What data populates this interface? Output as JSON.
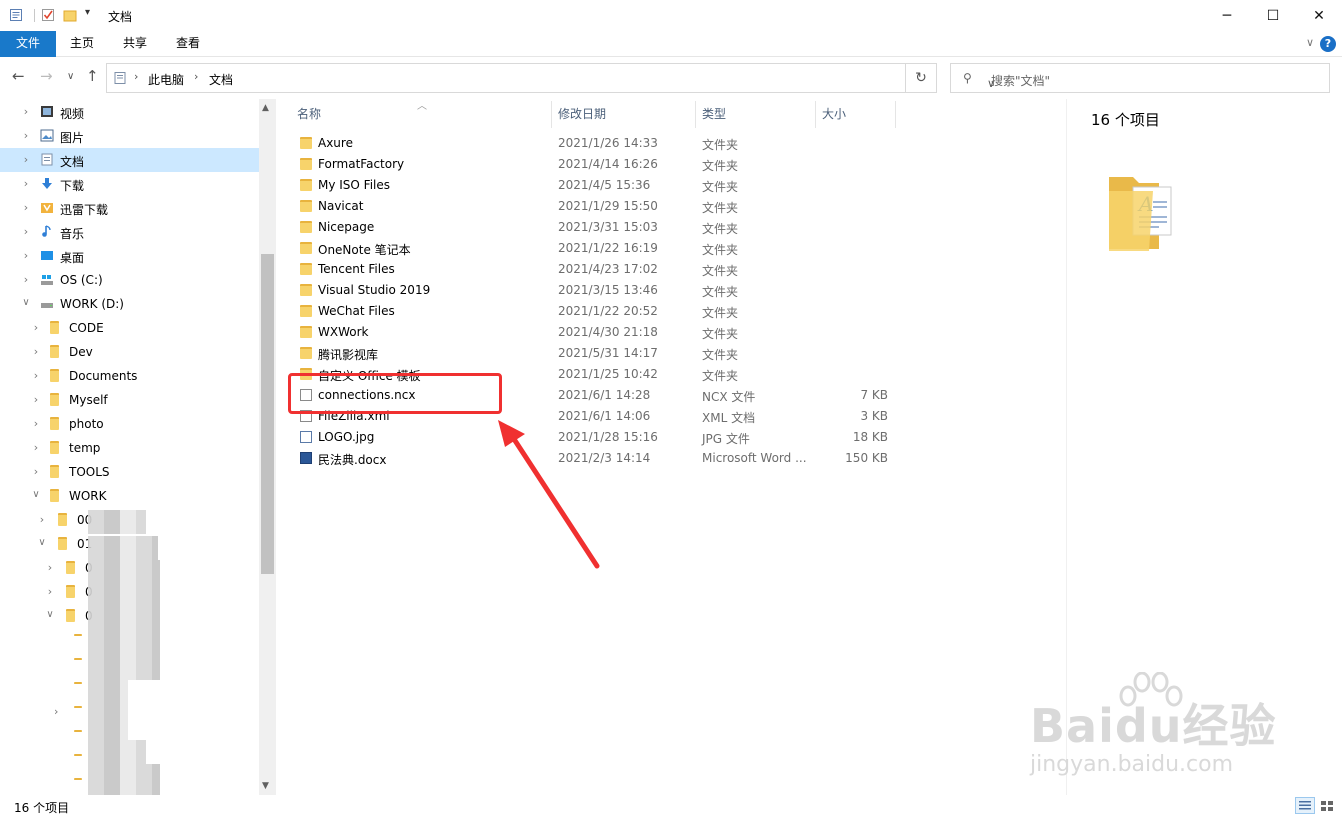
{
  "window": {
    "title": "文档"
  },
  "ribbon": {
    "tabs": [
      "文件",
      "主页",
      "共享",
      "查看"
    ],
    "help": "?"
  },
  "address": {
    "crumbs": [
      "此电脑",
      "文档"
    ],
    "search_placeholder": "搜索\"文档\""
  },
  "nav": {
    "items": [
      {
        "label": "视频",
        "icon": "video-icon"
      },
      {
        "label": "图片",
        "icon": "picture-icon"
      },
      {
        "label": "文档",
        "icon": "document-icon",
        "selected": true
      },
      {
        "label": "下载",
        "icon": "download-icon"
      },
      {
        "label": "迅雷下载",
        "icon": "thunder-icon"
      },
      {
        "label": "音乐",
        "icon": "music-icon"
      },
      {
        "label": "桌面",
        "icon": "desktop-icon"
      },
      {
        "label": "OS (C:)",
        "icon": "drive-icon"
      },
      {
        "label": "WORK (D:)",
        "icon": "drive-icon"
      },
      {
        "label": "CODE",
        "icon": "folder-icon"
      },
      {
        "label": "Dev",
        "icon": "folder-icon"
      },
      {
        "label": "Documents",
        "icon": "folder-icon"
      },
      {
        "label": "Myself",
        "icon": "folder-icon"
      },
      {
        "label": "photo",
        "icon": "folder-icon"
      },
      {
        "label": "temp",
        "icon": "folder-icon"
      },
      {
        "label": "TOOLS",
        "icon": "folder-icon"
      },
      {
        "label": "WORK",
        "icon": "folder-icon"
      },
      {
        "label": "00",
        "icon": "folder-icon"
      },
      {
        "label": "01",
        "icon": "folder-icon"
      },
      {
        "label": "0",
        "icon": "folder-icon"
      },
      {
        "label": "0",
        "icon": "folder-icon"
      },
      {
        "label": "0",
        "icon": "folder-icon"
      }
    ]
  },
  "columns": {
    "name": "名称",
    "date": "修改日期",
    "type": "类型",
    "size": "大小"
  },
  "files": [
    {
      "name": "Axure",
      "date": "2021/1/26 14:33",
      "type": "文件夹",
      "size": "",
      "kind": "folder"
    },
    {
      "name": "FormatFactory",
      "date": "2021/4/14 16:26",
      "type": "文件夹",
      "size": "",
      "kind": "folder"
    },
    {
      "name": "My ISO Files",
      "date": "2021/4/5 15:36",
      "type": "文件夹",
      "size": "",
      "kind": "folder"
    },
    {
      "name": "Navicat",
      "date": "2021/1/29 15:50",
      "type": "文件夹",
      "size": "",
      "kind": "folder"
    },
    {
      "name": "Nicepage",
      "date": "2021/3/31 15:03",
      "type": "文件夹",
      "size": "",
      "kind": "folder"
    },
    {
      "name": "OneNote 笔记本",
      "date": "2021/1/22 16:19",
      "type": "文件夹",
      "size": "",
      "kind": "folder"
    },
    {
      "name": "Tencent Files",
      "date": "2021/4/23 17:02",
      "type": "文件夹",
      "size": "",
      "kind": "folder"
    },
    {
      "name": "Visual Studio 2019",
      "date": "2021/3/15 13:46",
      "type": "文件夹",
      "size": "",
      "kind": "folder"
    },
    {
      "name": "WeChat Files",
      "date": "2021/1/22 20:52",
      "type": "文件夹",
      "size": "",
      "kind": "folder"
    },
    {
      "name": "WXWork",
      "date": "2021/4/30 21:18",
      "type": "文件夹",
      "size": "",
      "kind": "folder"
    },
    {
      "name": "腾讯影视库",
      "date": "2021/5/31 14:17",
      "type": "文件夹",
      "size": "",
      "kind": "folder"
    },
    {
      "name": "自定义 Office 模板",
      "date": "2021/1/25 10:42",
      "type": "文件夹",
      "size": "",
      "kind": "folder"
    },
    {
      "name": "connections.ncx",
      "date": "2021/6/1 14:28",
      "type": "NCX 文件",
      "size": "7 KB",
      "kind": "file"
    },
    {
      "name": "FileZilla.xml",
      "date": "2021/6/1 14:06",
      "type": "XML 文档",
      "size": "3 KB",
      "kind": "file"
    },
    {
      "name": "LOGO.jpg",
      "date": "2021/1/28 15:16",
      "type": "JPG 文件",
      "size": "18 KB",
      "kind": "image"
    },
    {
      "name": "民法典.docx",
      "date": "2021/2/3 14:14",
      "type": "Microsoft Word ...",
      "size": "150 KB",
      "kind": "word"
    }
  ],
  "preview": {
    "count": "16 个项目"
  },
  "status": {
    "count": "16 个项目"
  },
  "watermark": {
    "brand": "Baidu经验",
    "url": "jingyan.baidu.com"
  },
  "colors": {
    "accent": "#1979ca",
    "selection": "#cce8ff",
    "annotation": "#f03030"
  }
}
